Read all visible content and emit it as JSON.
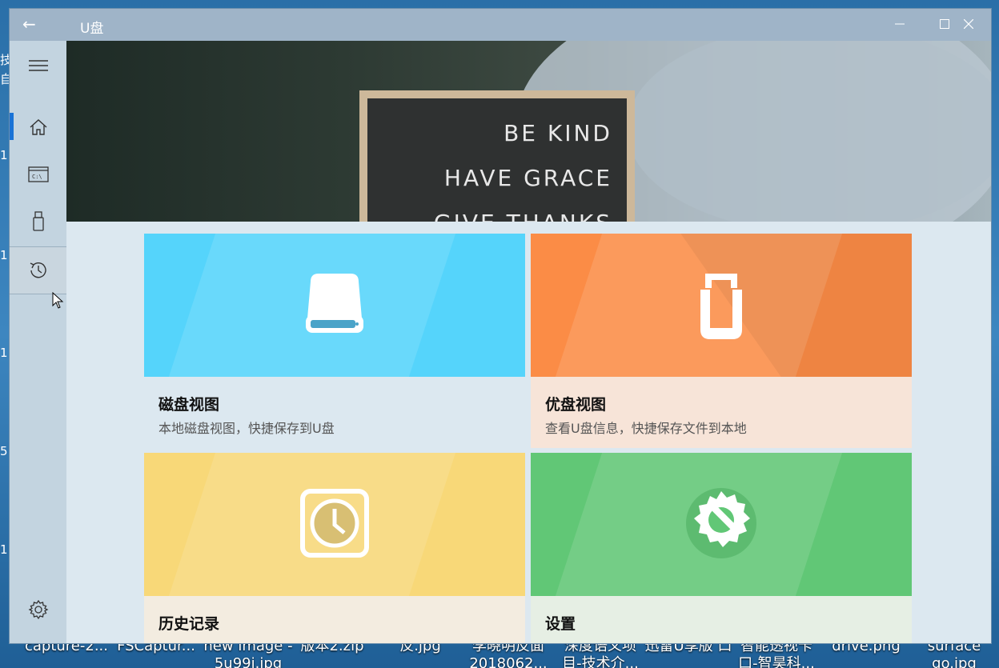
{
  "window": {
    "title": "U盘",
    "back_glyph": "←",
    "min_glyph": "—",
    "max_glyph": "☐",
    "close_glyph": "✕"
  },
  "rail": {
    "items": [
      {
        "name": "menu",
        "icon": "hamburger-icon"
      },
      {
        "name": "home",
        "icon": "home-icon",
        "selected_indicator": true
      },
      {
        "name": "disk",
        "icon": "cmd-window-icon"
      },
      {
        "name": "usb",
        "icon": "usb-drive-icon"
      },
      {
        "name": "history",
        "icon": "history-clock-icon",
        "hovered": true
      },
      {
        "name": "settings",
        "icon": "gear-icon"
      }
    ]
  },
  "hero": {
    "line1": "BE KIND",
    "line2": "HAVE GRACE",
    "line3": "GIVE THANKS"
  },
  "tiles": [
    {
      "title": "磁盘视图",
      "subtitle": "本地磁盘视图，快捷保存到U盘",
      "color": "#55d4fb",
      "icon": "hard-drive-icon"
    },
    {
      "title": "优盘视图",
      "subtitle": "查看U盘信息，快捷保存文件到本地",
      "color": "#fb8c46",
      "icon": "usb-u-icon"
    },
    {
      "title": "历史记录",
      "subtitle": "",
      "color": "#f8d878",
      "icon": "clock-icon"
    },
    {
      "title": "设置",
      "subtitle": "",
      "color": "#61c776",
      "icon": "settings-wrench-icon"
    }
  ],
  "desktop": {
    "left_chars": [
      "技",
      "自",
      "1.",
      "1.",
      "1.",
      "5",
      "1.",
      "1."
    ],
    "taskbar_labels": [
      "capture-2...",
      "FSCaptur...",
      "new image - 5u99i.jpg",
      "版本2.zip",
      "反.jpg",
      "李晓明反面 2018062...",
      "深度语义项 目-技术介...",
      "迅雷U享版 口",
      "智能透视卡 口-智昊科...",
      "drive.png",
      "surface go.jpg"
    ]
  }
}
